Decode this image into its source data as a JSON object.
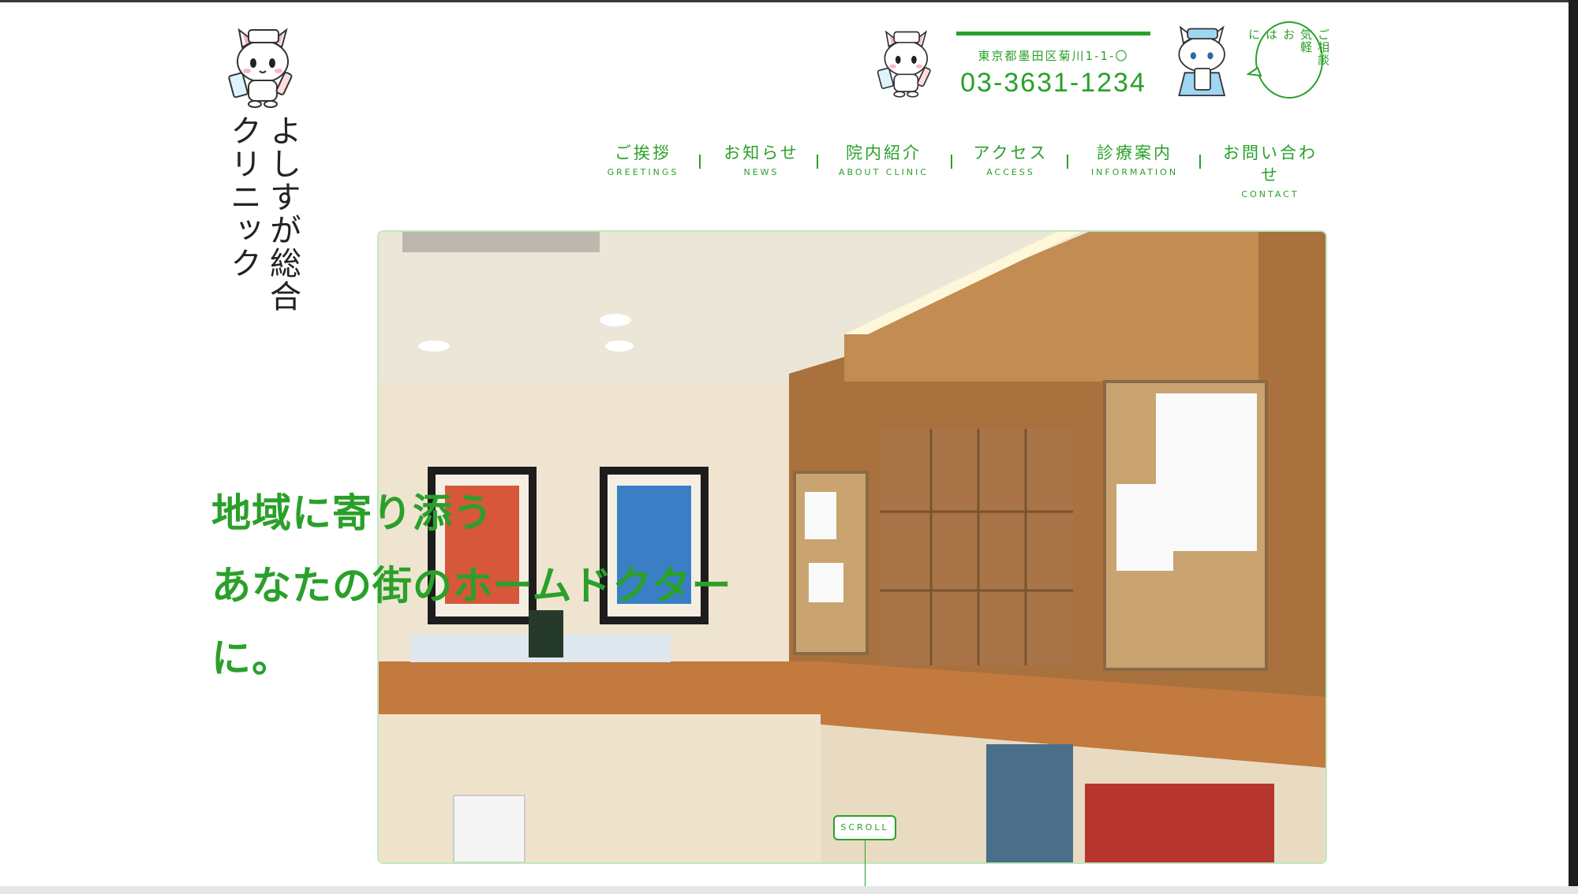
{
  "logo": {
    "line1": "よしすが総合",
    "line2": "クリニック"
  },
  "header": {
    "address": "東京都墨田区菊川1-1-〇",
    "tel": "03-3631-1234",
    "bubble_cols": [
      "ご相談",
      "気軽",
      "お",
      "は",
      "に"
    ]
  },
  "nav": {
    "items": [
      {
        "jp": "ご挨拶",
        "en": "GREETINGS"
      },
      {
        "jp": "お知らせ",
        "en": "NEWS"
      },
      {
        "jp": "院内紹介",
        "en": "ABOUT CLINIC"
      },
      {
        "jp": "アクセス",
        "en": "ACCESS"
      },
      {
        "jp": "診療案内",
        "en": "INFORMATION"
      },
      {
        "jp": "お問い合わせ",
        "en": "CONTACT"
      }
    ]
  },
  "hero": {
    "catch_line1": "地域に寄り添う",
    "catch_line2": "あなたの街のホームドクターに。",
    "scroll_label": "SCROLL"
  },
  "colors": {
    "accent": "#2aa02a",
    "frame": "#bfe9bf"
  }
}
